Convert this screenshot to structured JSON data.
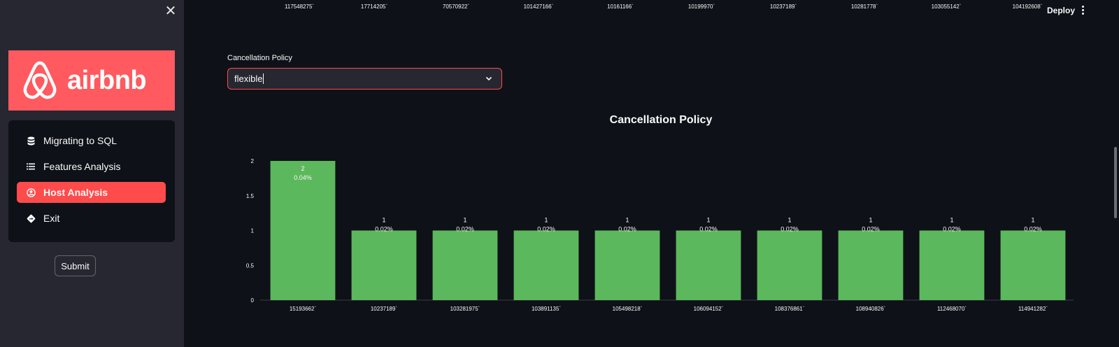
{
  "sidebar": {
    "logo_text": "airbnb",
    "menu": [
      {
        "label": "Migrating to SQL",
        "icon": "database-icon",
        "active": false
      },
      {
        "label": "Features Analysis",
        "icon": "list-icon",
        "active": false
      },
      {
        "label": "Host Analysis",
        "icon": "user-circle-icon",
        "active": true
      },
      {
        "label": "Exit",
        "icon": "diamond-arrow-icon",
        "active": false
      }
    ],
    "submit_label": "Submit"
  },
  "header": {
    "deploy_label": "Deploy",
    "top_axis_labels": [
      "117548275`",
      "17714205`",
      "70570922`",
      "101427166`",
      "10161166`",
      "10199970`",
      "10237189`",
      "10281778`",
      "103055142`",
      "104192608`"
    ]
  },
  "filter": {
    "label": "Cancellation Policy",
    "value": "flexible"
  },
  "colors": {
    "accent": "#ff4b4b",
    "logo_bg": "#ff5a5f",
    "bar": "#5cb85c",
    "background": "#0e1117",
    "sidebar_bg": "#262730"
  },
  "chart_data": {
    "type": "bar",
    "title": "Cancellation Policy",
    "categories": [
      "15193662`",
      "10237189`",
      "103281975`",
      "103891135`",
      "105498218`",
      "106094152`",
      "108376861`",
      "108940826`",
      "112468070`",
      "114941282`"
    ],
    "values": [
      2,
      1,
      1,
      1,
      1,
      1,
      1,
      1,
      1,
      1
    ],
    "percent_labels": [
      "0.04%",
      "0.02%",
      "0.02%",
      "0.02%",
      "0.02%",
      "0.02%",
      "0.02%",
      "0.02%",
      "0.02%",
      "0.02%"
    ],
    "ylim": [
      0,
      2
    ],
    "yticks": [
      "0",
      "0.5",
      "1",
      "1.5",
      "2"
    ],
    "xlabel": "",
    "ylabel": "",
    "grid": false
  }
}
